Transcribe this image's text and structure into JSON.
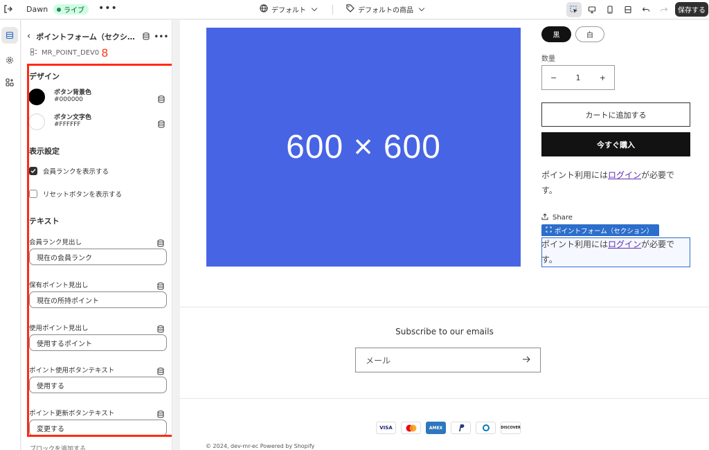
{
  "topbar": {
    "theme_name": "Dawn",
    "status_badge": "ライブ",
    "more": "•••",
    "template_label": "デフォルト",
    "product_label": "デフォルトの商品",
    "save_label": "保存する"
  },
  "sidebar": {
    "title": "ポイントフォーム（セクショ...",
    "more": "•••",
    "subtitle": "MR_POINT_DEV0",
    "subtitle_suffix": "8",
    "design_heading": "デザイン",
    "colors": [
      {
        "label": "ボタン背景色",
        "value": "#000000",
        "swatch": "#000000"
      },
      {
        "label": "ボタン文字色",
        "value": "#FFFFFF",
        "swatch": "#FFFFFF"
      }
    ],
    "display_heading": "表示設定",
    "checkboxes": [
      {
        "label": "会員ランクを表示する",
        "checked": true
      },
      {
        "label": "リセットボタンを表示する",
        "checked": false
      }
    ],
    "text_heading": "テキスト",
    "fields": [
      {
        "label": "会員ランク見出し",
        "value": "現在の会員ランク"
      },
      {
        "label": "保有ポイント見出し",
        "value": "現在の所持ポイント"
      },
      {
        "label": "使用ポイント見出し",
        "value": "使用するポイント"
      },
      {
        "label": "ポイント使用ボタンテキスト",
        "value": "使用する"
      },
      {
        "label": "ポイント更新ボタンテキスト",
        "value": "変更する"
      }
    ],
    "bottom_text": "ブロックを追加する"
  },
  "preview": {
    "placeholder_text": "600 × 600",
    "variants": [
      "黒",
      "白"
    ],
    "quantity_label": "数量",
    "quantity_value": "1",
    "qty_minus": "−",
    "qty_plus": "+",
    "add_to_cart": "カートに追加する",
    "buy_now": "今すぐ購入",
    "point_text_prefix": "ポイント利用には",
    "point_text_link": "ログイン",
    "point_text_suffix": "が必要で",
    "point_text_line2": "す。",
    "share_label": "Share",
    "section_tag": "ポイントフォーム（セクション）",
    "newsletter_title": "Subscribe to our emails",
    "email_placeholder": "メール",
    "payment_methods": [
      "VISA",
      "MC",
      "AMEX",
      "PayPal",
      "Diners",
      "DISCOVER"
    ],
    "copyright": "© 2024, dev-mr-ec Powered by Shopify"
  },
  "colors": {
    "accent_blue": "#2c6ecb",
    "placeholder_blue": "#4764e5",
    "annotation_red": "#ff2a12",
    "live_green": "#29845a"
  }
}
